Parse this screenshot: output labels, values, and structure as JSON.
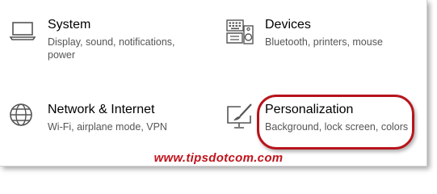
{
  "tiles": [
    {
      "title": "System",
      "description": "Display, sound, notifications, power",
      "icon": "laptop-icon"
    },
    {
      "title": "Devices",
      "description": "Bluetooth, printers, mouse",
      "icon": "keyboard-speaker-icon"
    },
    {
      "title": "Network & Internet",
      "description": "Wi-Fi, airplane mode, VPN",
      "icon": "globe-icon"
    },
    {
      "title": "Personalization",
      "description": "Background, lock screen, colors",
      "icon": "paint-monitor-icon"
    }
  ],
  "watermark": "www.tipsdotcom.com",
  "colors": {
    "highlight": "#b8141c",
    "watermark": "#c0141c",
    "icon": "#555555"
  }
}
